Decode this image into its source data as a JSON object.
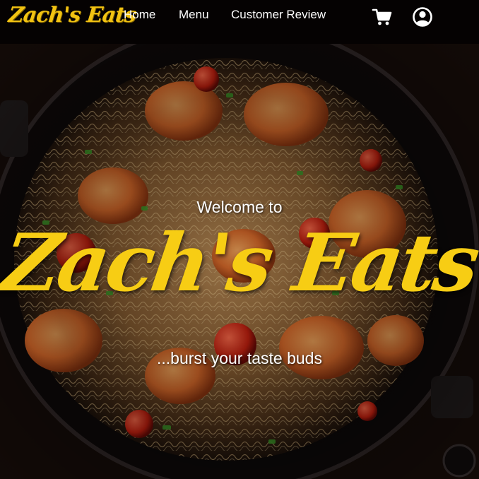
{
  "nav": {
    "brand": "Zach's Eats",
    "links": [
      "Home",
      "Menu",
      "Customer Review"
    ],
    "cart_icon": "shopping-cart-icon",
    "account_icon": "user-circle-icon"
  },
  "hero": {
    "welcome": "Welcome to",
    "title": "Zach's Eats",
    "tagline": "...burst your taste buds",
    "background_image": "shrimp-spaghetti-pan"
  },
  "colors": {
    "brand_yellow": "#f7cd14",
    "nav_background": "#050202",
    "text": "#ffffff"
  }
}
